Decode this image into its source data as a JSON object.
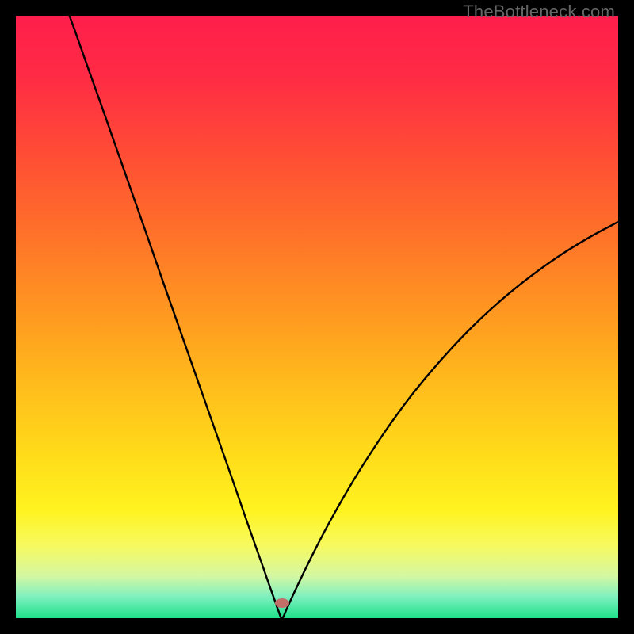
{
  "watermark": "TheBottleneck.com",
  "gradient": {
    "stops": [
      {
        "offset": 0.0,
        "color": "#ff1e4b"
      },
      {
        "offset": 0.1,
        "color": "#ff2b45"
      },
      {
        "offset": 0.22,
        "color": "#ff4a36"
      },
      {
        "offset": 0.35,
        "color": "#ff6e2a"
      },
      {
        "offset": 0.48,
        "color": "#ff9421"
      },
      {
        "offset": 0.6,
        "color": "#ffb81c"
      },
      {
        "offset": 0.72,
        "color": "#ffd91a"
      },
      {
        "offset": 0.82,
        "color": "#fff31f"
      },
      {
        "offset": 0.88,
        "color": "#f7fa60"
      },
      {
        "offset": 0.93,
        "color": "#d4f7a2"
      },
      {
        "offset": 0.965,
        "color": "#7ef0c0"
      },
      {
        "offset": 1.0,
        "color": "#1de089"
      }
    ]
  },
  "marker": {
    "x_frac": 0.442,
    "y_frac": 0.975,
    "color": "#c26f6a"
  },
  "chart_data": {
    "type": "line",
    "title": "",
    "xlabel": "",
    "ylabel": "",
    "xlim": [
      0,
      100
    ],
    "ylim": [
      0,
      100
    ],
    "x": [
      8.9,
      10,
      12,
      14,
      16,
      18,
      20,
      22,
      24,
      26,
      28,
      30,
      32,
      34,
      36,
      38,
      40,
      41,
      42,
      43,
      43.6,
      44.2,
      45,
      46,
      48,
      50,
      52,
      55,
      58,
      62,
      66,
      70,
      75,
      80,
      85,
      90,
      95,
      100
    ],
    "values": [
      100,
      97,
      91.3,
      85.7,
      80,
      74.3,
      68.6,
      62.9,
      57.1,
      51.4,
      45.7,
      40,
      34.3,
      28.6,
      22.9,
      17.1,
      11.4,
      8.6,
      5.7,
      2.9,
      1.2,
      0.0,
      1.6,
      3.8,
      8.0,
      12.0,
      15.8,
      21.1,
      26.0,
      32.0,
      37.4,
      42.2,
      47.6,
      52.3,
      56.4,
      60.0,
      63.1,
      65.8
    ],
    "series": [
      {
        "name": "bottleneck-curve",
        "type": "line"
      }
    ],
    "annotations": [
      {
        "type": "marker",
        "x": 44.2,
        "y": 2.5,
        "label": "optimal-point"
      }
    ]
  }
}
